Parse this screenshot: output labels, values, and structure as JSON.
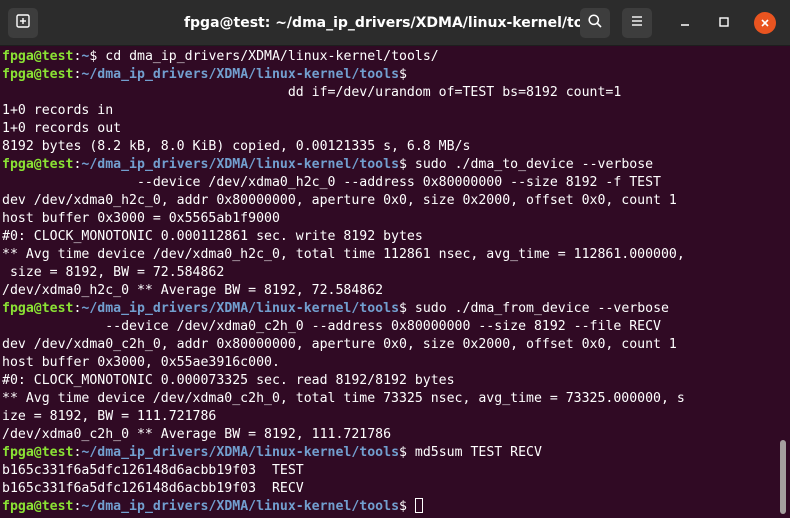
{
  "window": {
    "title": "fpga@test: ~/dma_ip_drivers/XDMA/linux-kernel/tools"
  },
  "icons": {
    "new_tab": "new-tab-icon",
    "search": "search-icon",
    "menu": "hamburger-menu-icon",
    "minimize": "minimize-icon",
    "maximize": "maximize-icon",
    "close": "close-icon"
  },
  "colors": {
    "background": "#300a24",
    "titlebar": "#2c2c2c",
    "prompt_user": "#8ae234",
    "prompt_path": "#729fcf",
    "text": "#ffffff",
    "close_button": "#e95420"
  },
  "terminal": {
    "prompt_user": "fpga@test",
    "lines": [
      {
        "path": "~",
        "text": "$ cd dma_ip_drivers/XDMA/linux-kernel/tools/"
      },
      {
        "path": "~/dma_ip_drivers/XDMA/linux-kernel/tools",
        "text": "$"
      },
      {
        "text": "                                    dd if=/dev/urandom of=TEST bs=8192 count=1"
      },
      {
        "text": "1+0 records in"
      },
      {
        "text": "1+0 records out"
      },
      {
        "text": "8192 bytes (8.2 kB, 8.0 KiB) copied, 0.00121335 s, 6.8 MB/s"
      },
      {
        "path": "~/dma_ip_drivers/XDMA/linux-kernel/tools",
        "text": "$ sudo ./dma_to_device --verbose"
      },
      {
        "text": "                 --device /dev/xdma0_h2c_0 --address 0x80000000 --size 8192 -f TEST"
      },
      {
        "text": "dev /dev/xdma0_h2c_0, addr 0x80000000, aperture 0x0, size 0x2000, offset 0x0, count 1"
      },
      {
        "text": "host buffer 0x3000 = 0x5565ab1f9000"
      },
      {
        "text": "#0: CLOCK_MONOTONIC 0.000112861 sec. write 8192 bytes"
      },
      {
        "text": "** Avg time device /dev/xdma0_h2c_0, total time 112861 nsec, avg_time = 112861.000000,"
      },
      {
        "text": " size = 8192, BW = 72.584862"
      },
      {
        "text": "/dev/xdma0_h2c_0 ** Average BW = 8192, 72.584862"
      },
      {
        "path": "~/dma_ip_drivers/XDMA/linux-kernel/tools",
        "text": "$ sudo ./dma_from_device --verbose"
      },
      {
        "text": "             --device /dev/xdma0_c2h_0 --address 0x80000000 --size 8192 --file RECV"
      },
      {
        "text": "dev /dev/xdma0_c2h_0, addr 0x80000000, aperture 0x0, size 0x2000, offset 0x0, count 1"
      },
      {
        "text": "host buffer 0x3000, 0x55ae3916c000."
      },
      {
        "text": "#0: CLOCK_MONOTONIC 0.000073325 sec. read 8192/8192 bytes"
      },
      {
        "text": "** Avg time device /dev/xdma0_c2h_0, total time 73325 nsec, avg_time = 73325.000000, s"
      },
      {
        "text": "ize = 8192, BW = 111.721786"
      },
      {
        "text": "/dev/xdma0_c2h_0 ** Average BW = 8192, 111.721786"
      },
      {
        "path": "~/dma_ip_drivers/XDMA/linux-kernel/tools",
        "text": "$ md5sum TEST RECV"
      },
      {
        "text": "b165c331f6a5dfc126148d6acbb19f03  TEST"
      },
      {
        "text": "b165c331f6a5dfc126148d6acbb19f03  RECV"
      },
      {
        "path": "~/dma_ip_drivers/XDMA/linux-kernel/tools",
        "text": "$ ",
        "cursor": true
      }
    ]
  }
}
